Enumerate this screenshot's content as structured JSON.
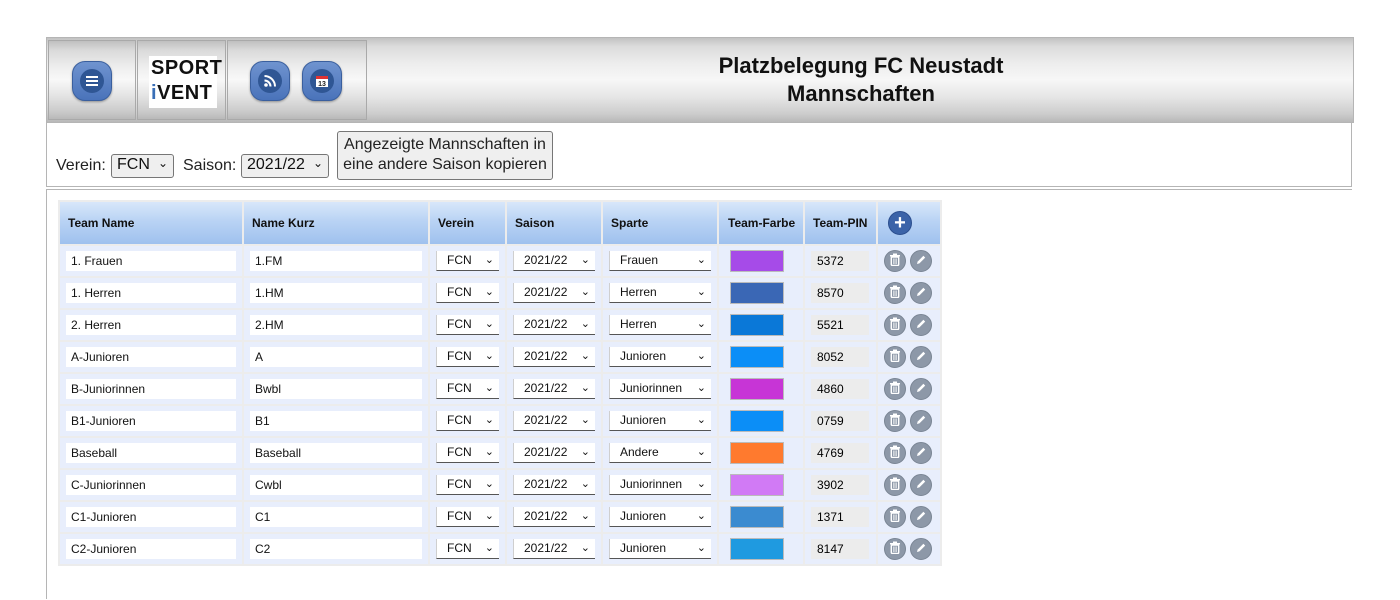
{
  "header": {
    "logo_line1": "SPORT",
    "logo_i": "i",
    "logo_line2": "VENT",
    "title_line1": "Platzbelegung FC Neustadt",
    "title_line2": "Mannschaften"
  },
  "filter": {
    "verein_label": "Verein:",
    "verein_value": "FCN",
    "saison_label": "Saison:",
    "saison_value": "2021/22",
    "copy_line1": "Angezeigte Mannschaften in",
    "copy_line2": "eine andere Saison kopieren"
  },
  "table": {
    "columns": [
      "Team Name",
      "Name Kurz",
      "Verein",
      "Saison",
      "Sparte",
      "Team-Farbe",
      "Team-PIN"
    ],
    "rows": [
      {
        "name": "1. Frauen",
        "kurz": "1.FM",
        "verein": "FCN",
        "saison": "2021/22",
        "sparte": "Frauen",
        "farbe": "#a64be8",
        "pin": "5372"
      },
      {
        "name": "1. Herren",
        "kurz": "1.HM",
        "verein": "FCN",
        "saison": "2021/22",
        "sparte": "Herren",
        "farbe": "#3a67b5",
        "pin": "8570"
      },
      {
        "name": "2. Herren",
        "kurz": "2.HM",
        "verein": "FCN",
        "saison": "2021/22",
        "sparte": "Herren",
        "farbe": "#0a78d8",
        "pin": "5521"
      },
      {
        "name": "A-Junioren",
        "kurz": "A",
        "verein": "FCN",
        "saison": "2021/22",
        "sparte": "Junioren",
        "farbe": "#0b8ef7",
        "pin": "8052"
      },
      {
        "name": "B-Juniorinnen",
        "kurz": "Bwbl",
        "verein": "FCN",
        "saison": "2021/22",
        "sparte": "Juniorinnen",
        "farbe": "#c735d6",
        "pin": "4860"
      },
      {
        "name": "B1-Junioren",
        "kurz": "B1",
        "verein": "FCN",
        "saison": "2021/22",
        "sparte": "Junioren",
        "farbe": "#0b8ef7",
        "pin": "0759"
      },
      {
        "name": "Baseball",
        "kurz": "Baseball",
        "verein": "FCN",
        "saison": "2021/22",
        "sparte": "Andere",
        "farbe": "#ff7a2e",
        "pin": "4769"
      },
      {
        "name": "C-Juniorinnen",
        "kurz": "Cwbl",
        "verein": "FCN",
        "saison": "2021/22",
        "sparte": "Juniorinnen",
        "farbe": "#d17af5",
        "pin": "3902"
      },
      {
        "name": "C1-Junioren",
        "kurz": "C1",
        "verein": "FCN",
        "saison": "2021/22",
        "sparte": "Junioren",
        "farbe": "#3b8bd0",
        "pin": "1371"
      },
      {
        "name": "C2-Junioren",
        "kurz": "C2",
        "verein": "FCN",
        "saison": "2021/22",
        "sparte": "Junioren",
        "farbe": "#1f9ae0",
        "pin": "8147"
      }
    ]
  },
  "icons": {
    "menu": "menu-icon",
    "rss": "rss-icon",
    "calendar": "calendar-icon",
    "calendar_day": "13",
    "add": "plus-icon",
    "delete": "trash-icon",
    "edit": "pencil-icon"
  }
}
